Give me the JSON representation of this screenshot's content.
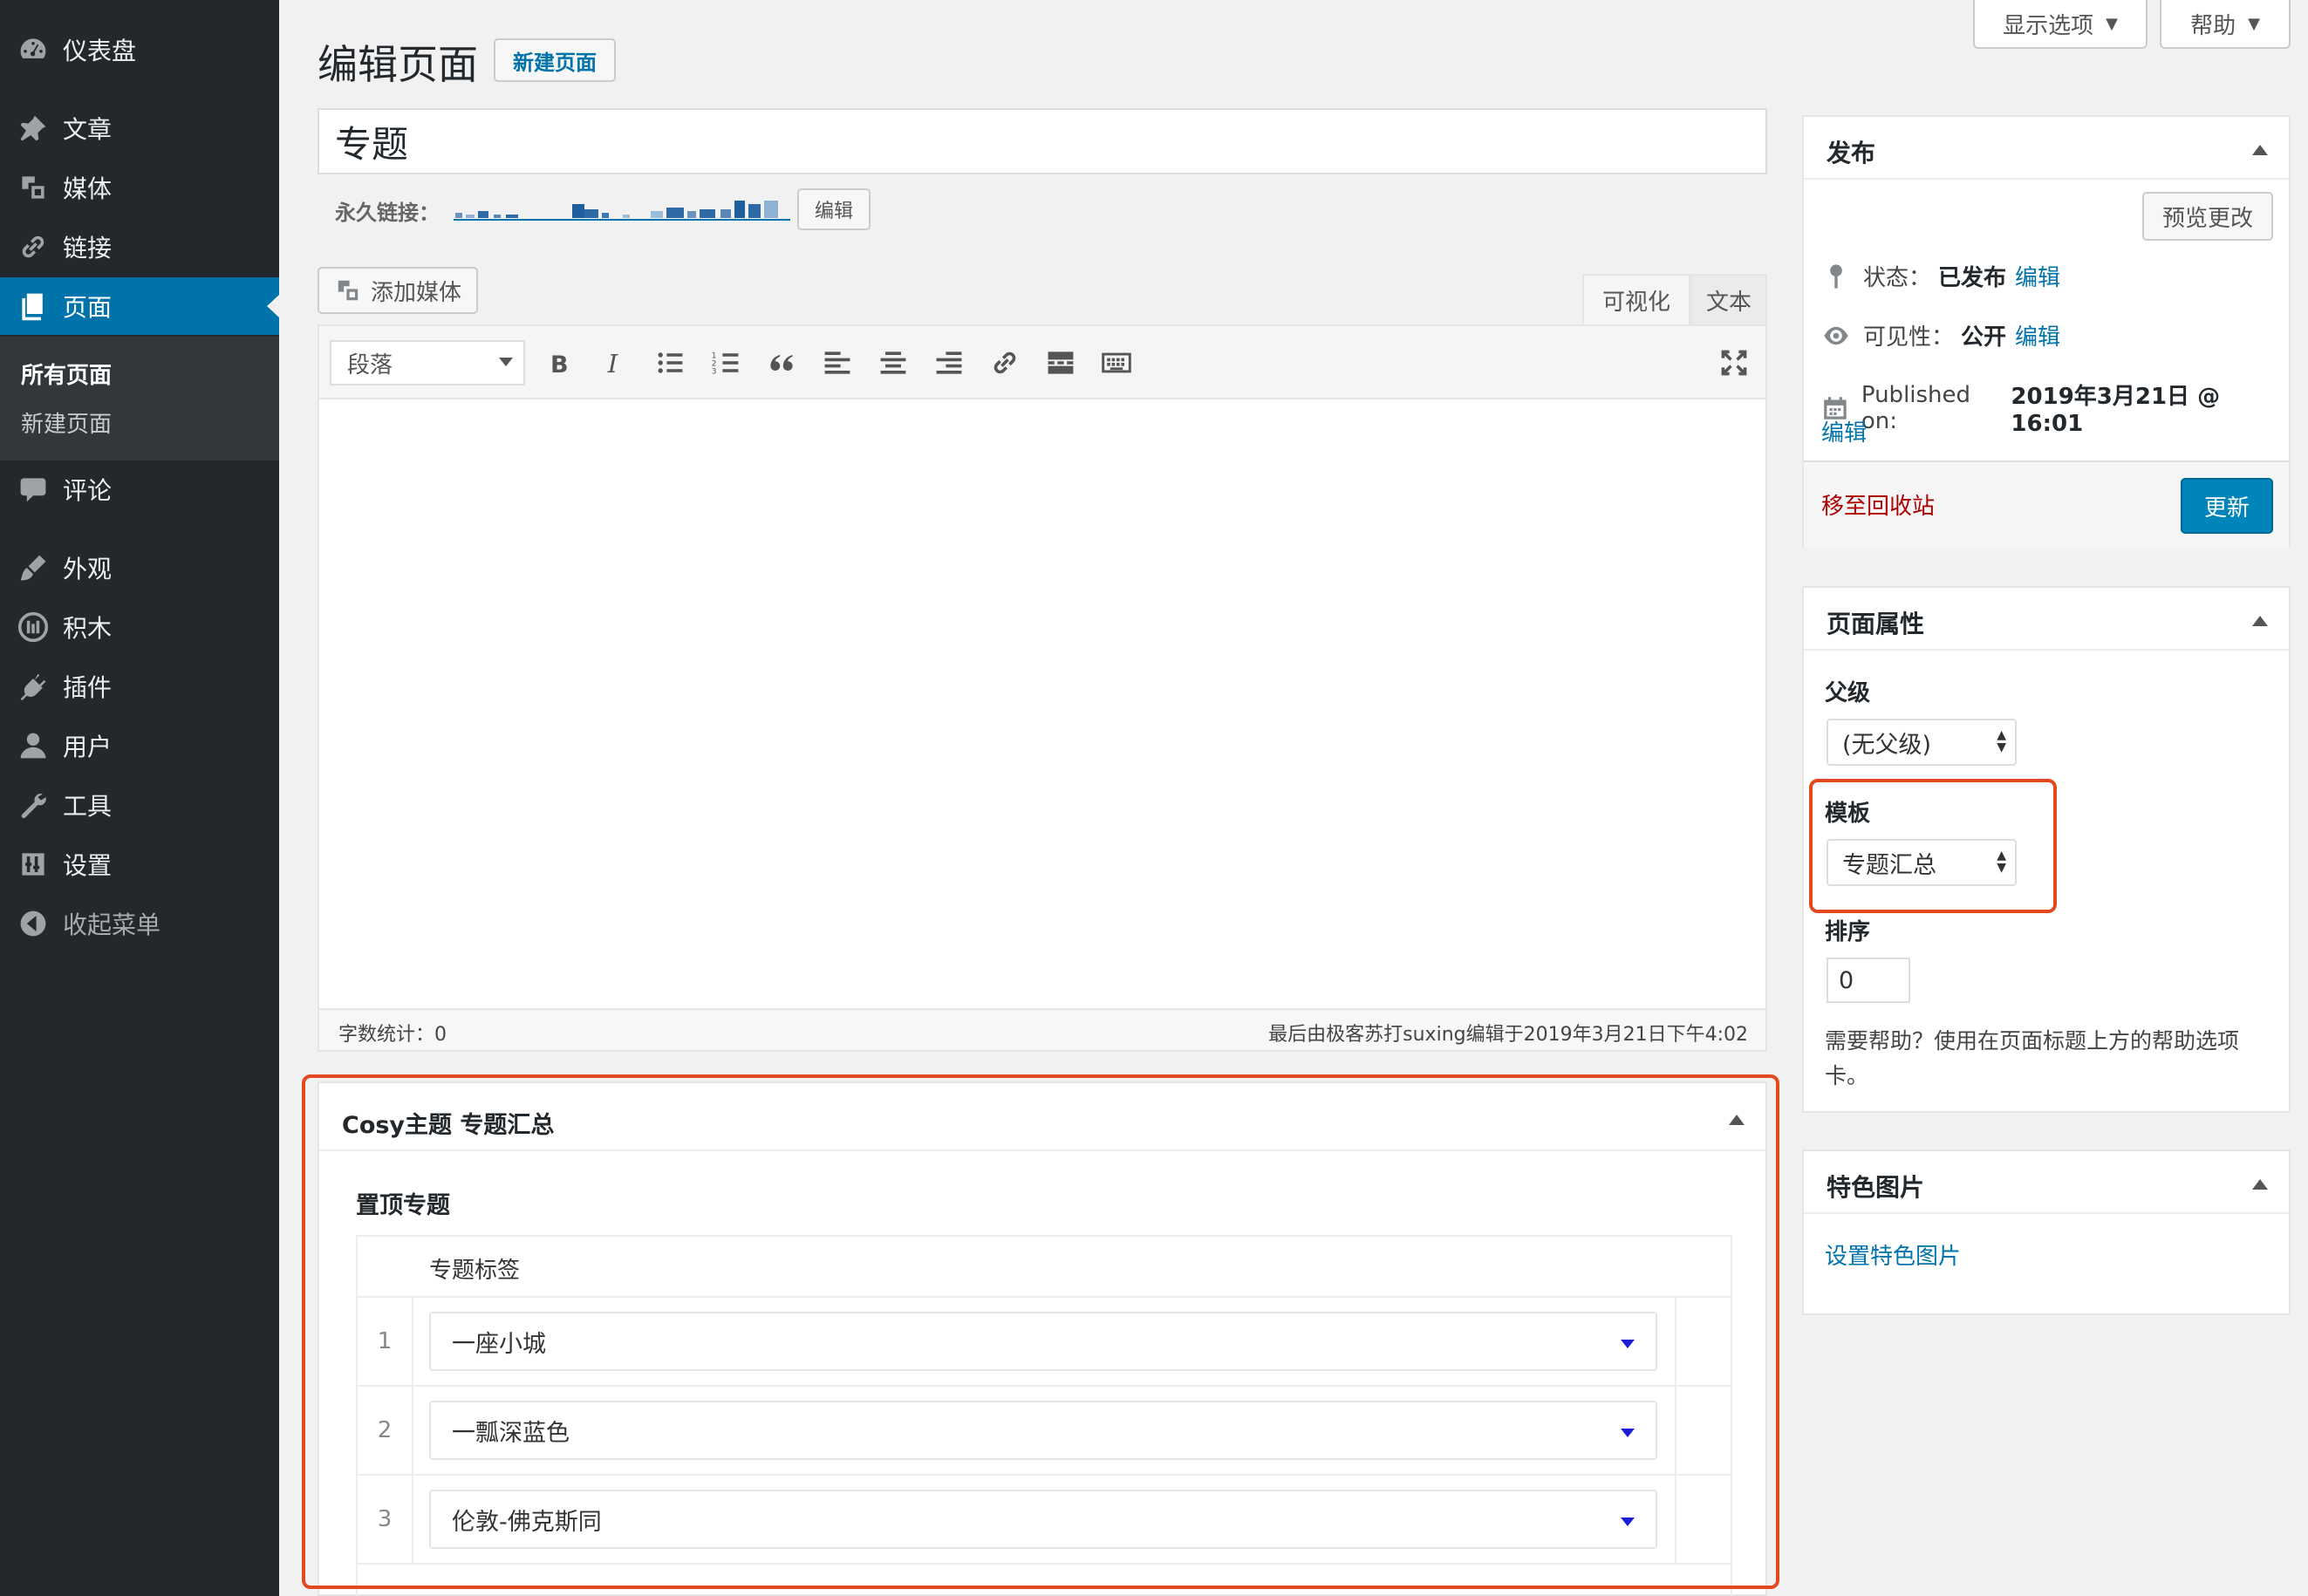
{
  "sidebar": {
    "items": [
      {
        "label": "仪表盘",
        "icon": "dashboard-icon"
      },
      {
        "label": "文章",
        "icon": "pin-icon"
      },
      {
        "label": "媒体",
        "icon": "media-icon"
      },
      {
        "label": "链接",
        "icon": "link-icon"
      },
      {
        "label": "页面",
        "icon": "pages-icon"
      },
      {
        "label": "评论",
        "icon": "comment-icon"
      },
      {
        "label": "外观",
        "icon": "brush-icon"
      },
      {
        "label": "积木",
        "icon": "blocks-icon"
      },
      {
        "label": "插件",
        "icon": "plugin-icon"
      },
      {
        "label": "用户",
        "icon": "user-icon"
      },
      {
        "label": "工具",
        "icon": "wrench-icon"
      },
      {
        "label": "设置",
        "icon": "settings-icon"
      }
    ],
    "submenu": [
      "所有页面",
      "新建页面"
    ],
    "collapse_label": "收起菜单"
  },
  "header": {
    "title": "编辑页面",
    "add_new": "新建页面",
    "screen_options": "显示选项",
    "help": "帮助"
  },
  "editor": {
    "title_value": "专题",
    "permalink_label": "永久链接：",
    "permalink_edit": "编辑",
    "add_media": "添加媒体",
    "tab_visual": "可视化",
    "tab_text": "文本",
    "format": "段落",
    "word_count": "字数统计：0",
    "last_edit": "最后由极客苏打suxing编辑于2019年3月21日下午4:02"
  },
  "cosy": {
    "title": "Cosy主题 专题汇总",
    "section": "置顶专题",
    "column": "专题标签",
    "rows": [
      {
        "num": "1",
        "value": "一座小城"
      },
      {
        "num": "2",
        "value": "一瓢深蓝色"
      },
      {
        "num": "3",
        "value": "伦敦-佛克斯同"
      }
    ]
  },
  "publish": {
    "title": "发布",
    "preview": "预览更改",
    "status_label": "状态：",
    "status_value": "已发布",
    "visibility_label": "可见性：",
    "visibility_value": "公开",
    "published_label": "Published on:",
    "published_value": "2019年3月21日 @ 16:01",
    "edit": "编辑",
    "trash": "移至回收站",
    "update": "更新"
  },
  "attributes": {
    "title": "页面属性",
    "parent_label": "父级",
    "parent_value": "(无父级)",
    "template_label": "模板",
    "template_value": "专题汇总",
    "order_label": "排序",
    "order_value": "0",
    "help_text": "需要帮助？使用在页面标题上方的帮助选项卡。"
  },
  "featured": {
    "title": "特色图片",
    "set_link": "设置特色图片"
  },
  "colors": {
    "sidebar_bg": "#23282d",
    "accent": "#0073aa",
    "highlight": "#e2491f"
  }
}
